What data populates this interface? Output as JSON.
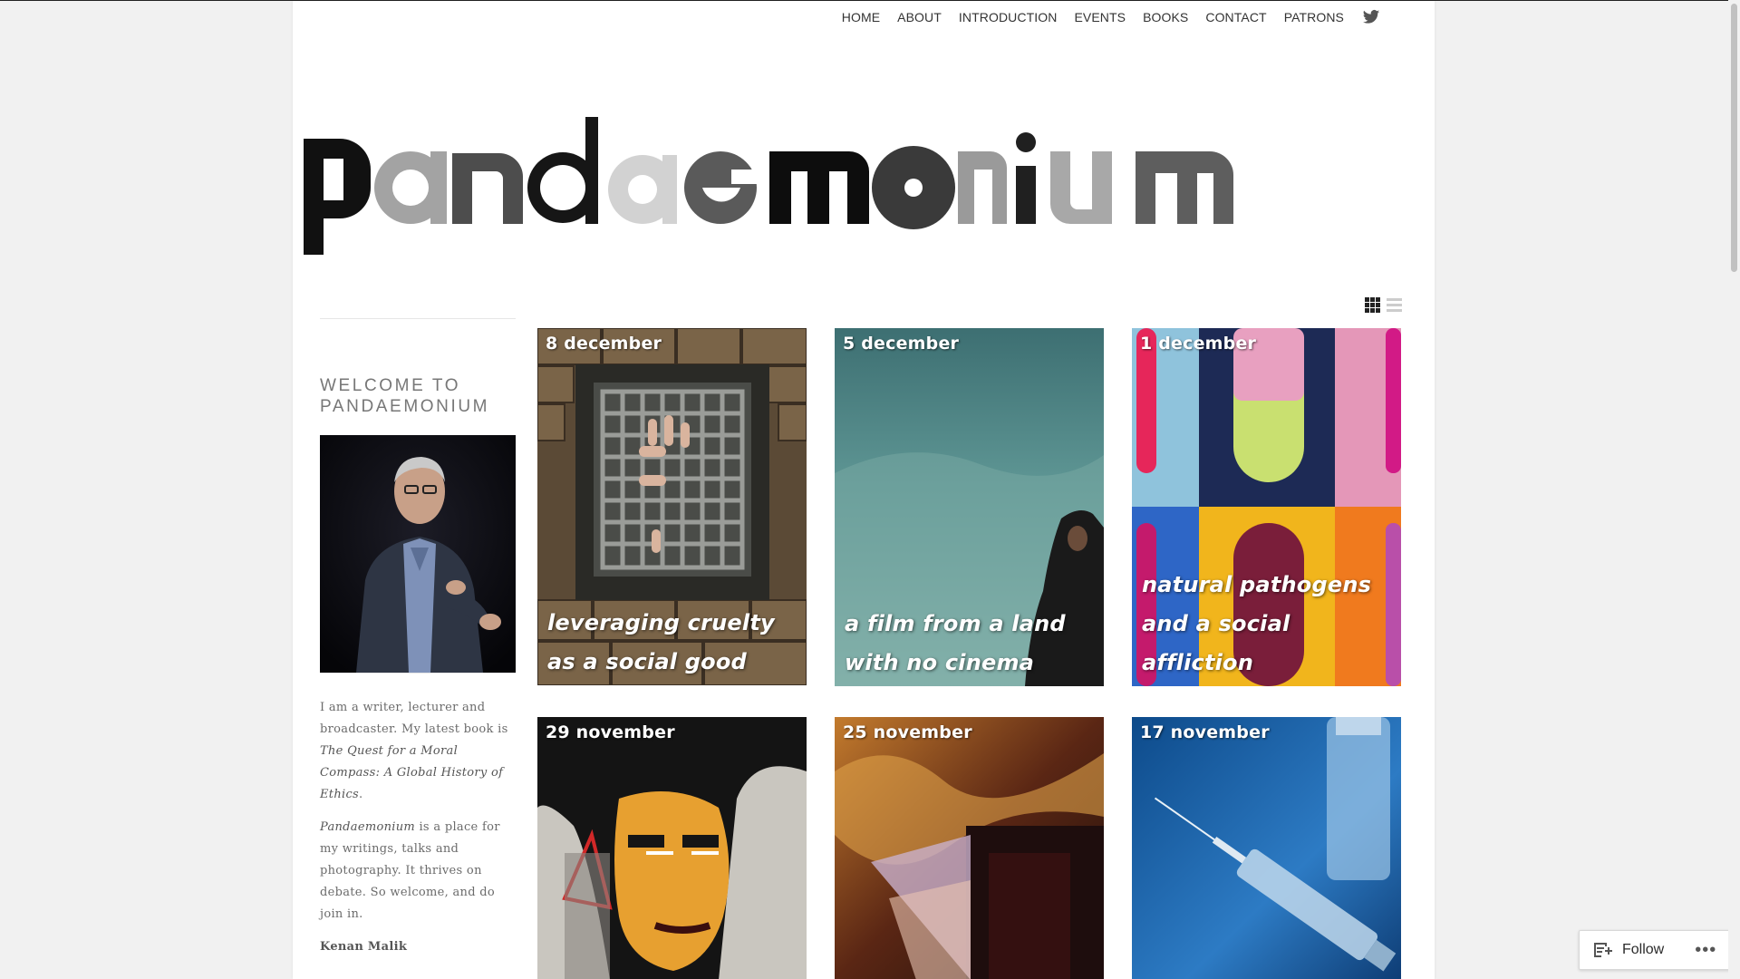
{
  "nav": {
    "items": [
      {
        "label": "HOME"
      },
      {
        "label": "ABOUT"
      },
      {
        "label": "INTRODUCTION"
      },
      {
        "label": "EVENTS"
      },
      {
        "label": "BOOKS"
      },
      {
        "label": "CONTACT"
      },
      {
        "label": "PATRONS"
      }
    ],
    "social_icon": "twitter-icon"
  },
  "logo": {
    "letters": [
      "p",
      "a",
      "n",
      "d",
      "a",
      "e",
      "m",
      "o",
      "n",
      "i",
      "u",
      "m"
    ],
    "colors": [
      "#111111",
      "#a3a3a3",
      "#4d4d4d",
      "#161616",
      "#d2d2d2",
      "#5a5a5a",
      "#0d0d0d",
      "#3a3a3a",
      "#9a9a9a",
      "#202020",
      "#a8a8a8",
      "#5e5e5e"
    ]
  },
  "view_toggle": {
    "grid_icon": "grid-view-icon",
    "list_icon": "list-view-icon"
  },
  "sidebar": {
    "widget_title": "WELCOME TO PANDAEMONIUM",
    "bio": {
      "p1_a": "I am a writer, lecturer and broadcaster. My latest book is ",
      "p1_book": "The Quest for a Moral Compass: A Global History of Ethics",
      "p1_b": ".",
      "p2_title": "Pandaemonium",
      "p2_rest": " is a place for my writings, talks and photography. It thrives on debate. So welcome, and do join in.",
      "signature": "Kenan Malik"
    }
  },
  "posts": [
    {
      "date": "8 december",
      "caption": "leveraging cruelty as a social good"
    },
    {
      "date": "5 december",
      "caption": "a film from a land with no cinema"
    },
    {
      "date": "1 december",
      "caption": "natural pathogens and a social affliction"
    },
    {
      "date": "29 november",
      "caption": ""
    },
    {
      "date": "25 november",
      "caption": ""
    },
    {
      "date": "17 november",
      "caption": ""
    }
  ],
  "follow": {
    "label": "Follow",
    "more": "•••"
  },
  "colors": {
    "nav_text": "#333333",
    "sidebar_text": "#6b6b6b",
    "page_bg": "#f1f1f1"
  }
}
